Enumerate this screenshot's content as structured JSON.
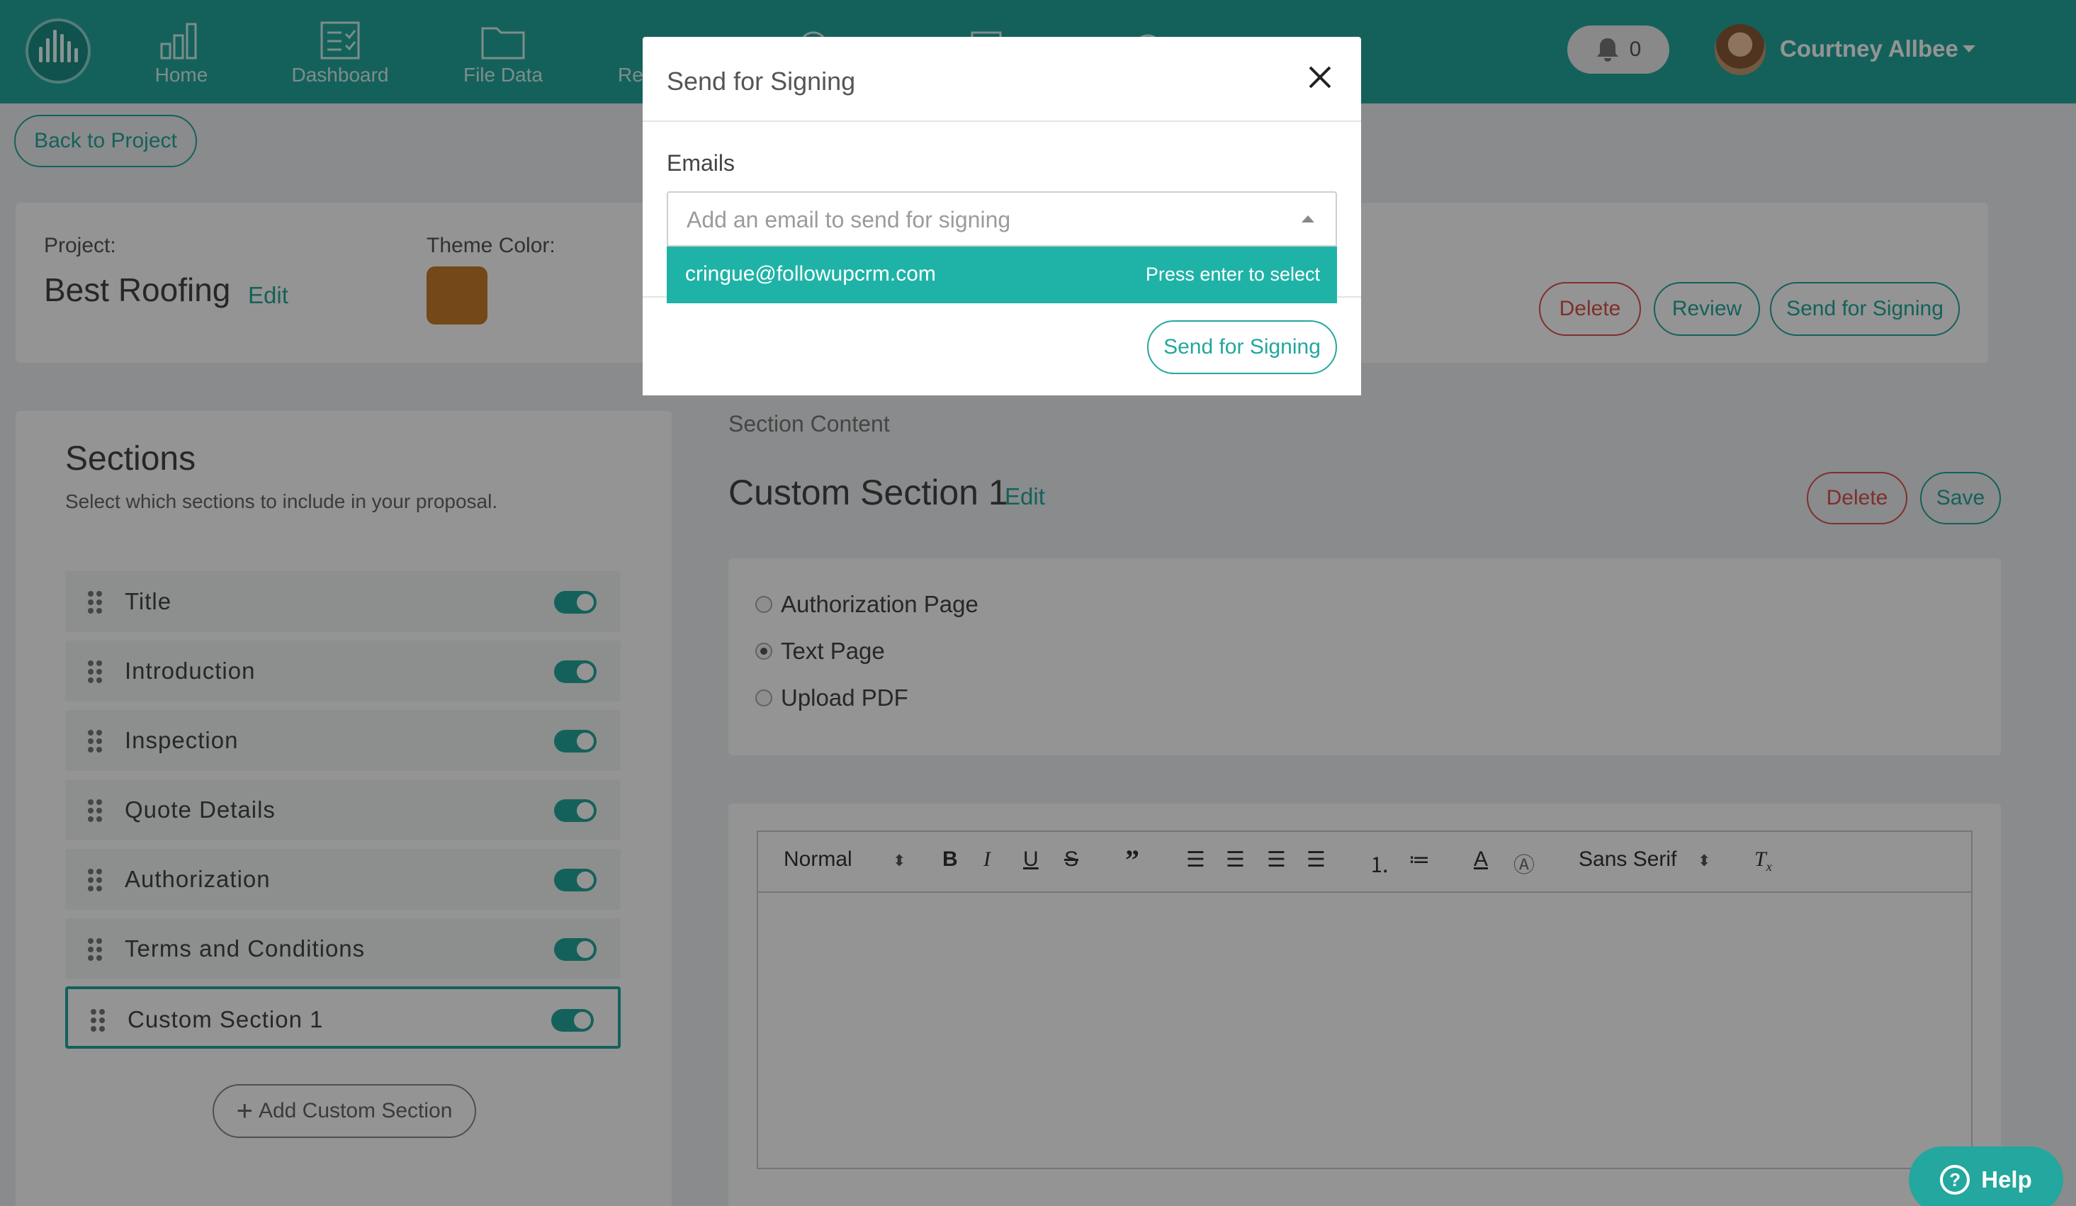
{
  "nav": {
    "items": [
      {
        "label": "Home",
        "icon": "bar-chart-icon"
      },
      {
        "label": "Dashboard",
        "icon": "clipboard-check-icon"
      },
      {
        "label": "File Data",
        "icon": "folder-icon"
      },
      {
        "label": "Re",
        "icon": "search-icon"
      },
      {
        "label": "",
        "icon": "cloud-icon"
      },
      {
        "label": "",
        "icon": "documents-icon"
      },
      {
        "label": "",
        "icon": "location-icon"
      },
      {
        "label": "",
        "icon": "gear-icon"
      }
    ],
    "notification_count": "0",
    "user_name": "Courtney Allbee"
  },
  "project": {
    "back_label": "Back to Project",
    "project_label": "Project:",
    "project_name": "Best Roofing",
    "edit_label": "Edit",
    "theme_label": "Theme Color:",
    "theme_color": "#c97d2c",
    "delete_label": "Delete",
    "review_label": "Review",
    "send_label": "Send for Signing"
  },
  "sections": {
    "title": "Sections",
    "subtitle": "Select which sections to include in your proposal.",
    "items": [
      {
        "label": "Title",
        "enabled": true
      },
      {
        "label": "Introduction",
        "enabled": true
      },
      {
        "label": "Inspection",
        "enabled": true
      },
      {
        "label": "Quote Details",
        "enabled": true
      },
      {
        "label": "Authorization",
        "enabled": true
      },
      {
        "label": "Terms and Conditions",
        "enabled": true
      },
      {
        "label": "Custom Section 1",
        "enabled": true
      }
    ],
    "add_label": "Add Custom Section"
  },
  "content": {
    "header": "Section Content",
    "title": "Custom Section 1",
    "edit_label": "Edit",
    "delete_label": "Delete",
    "save_label": "Save",
    "page_types": [
      {
        "label": "Authorization Page",
        "checked": false
      },
      {
        "label": "Text Page",
        "checked": true
      },
      {
        "label": "Upload PDF",
        "checked": false
      }
    ],
    "toolbar": {
      "heading_select": "Normal",
      "font_select": "Sans Serif"
    }
  },
  "modal": {
    "title": "Send for Signing",
    "emails_label": "Emails",
    "email_placeholder": "Add an email to send for signing",
    "option_email": "cringue@followupcrm.com",
    "option_hint": "Press enter to select",
    "submit_label": "Send for Signing"
  },
  "help": {
    "label": "Help"
  },
  "colors": {
    "accent": "#23a79e",
    "danger": "#d9534f"
  }
}
